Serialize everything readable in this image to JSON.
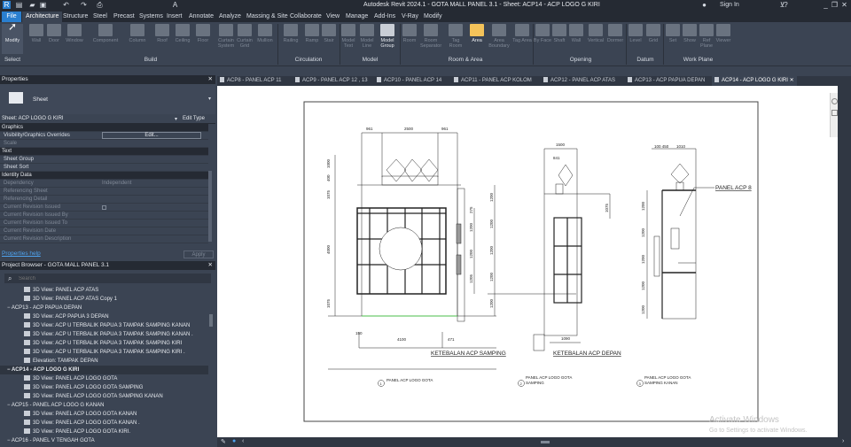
{
  "window": {
    "title": "Autodesk Revit 2024.1 - GOTA MALL PANEL 3.1 - Sheet: ACP14 - ACP LOGO G KIRI",
    "sign_in": "Sign In"
  },
  "ribbon_tabs": [
    "File",
    "Architecture",
    "Structure",
    "Steel",
    "Precast",
    "Systems",
    "Insert",
    "Annotate",
    "Analyze",
    "Massing & Site",
    "Collaborate",
    "View",
    "Manage",
    "Add-Ins",
    "V-Ray",
    "Modify"
  ],
  "tools": {
    "modify": "Modify",
    "wall": "Wall",
    "door": "Door",
    "window": "Window",
    "component": "Component",
    "column": "Column",
    "roof": "Roof",
    "ceiling": "Ceiling",
    "floor": "Floor",
    "curtain_system": "Curtain System",
    "curtain_grid": "Curtain Grid",
    "mullion": "Mullion",
    "railing": "Railing",
    "ramp": "Ramp",
    "stair": "Stair",
    "model_text": "Model Text",
    "model_line": "Model Line",
    "model_group": "Model Group",
    "room": "Room",
    "room_separator": "Room Separator",
    "tag_room": "Tag Room",
    "area": "Area",
    "area_boundary": "Area Boundary",
    "tag_area": "Tag Area",
    "by_face": "By Face",
    "shaft": "Shaft",
    "wall_opening": "Wall",
    "vertical": "Vertical",
    "dormer": "Dormer",
    "level": "Level",
    "grid": "Grid",
    "set": "Set",
    "show": "Show",
    "ref_plane": "Ref Plane",
    "viewer": "Viewer"
  },
  "panels": {
    "select": "Select",
    "build": "Build",
    "circulation": "Circulation",
    "model": "Model",
    "room_area": "Room & Area",
    "opening": "Opening",
    "datum": "Datum",
    "work_plane": "Work Plane"
  },
  "properties": {
    "title": "Properties",
    "type": "Sheet",
    "selector": "Sheet: ACP LOGO G KIRI",
    "edit_type": "Edit Type",
    "help": "Properties help",
    "apply": "Apply",
    "groups": {
      "graphics": "Graphics",
      "text": "Text",
      "identity": "Identity Data"
    },
    "rows": {
      "vis": "Visibility/Graphics Overrides",
      "vis_btn": "Edit...",
      "scale": "Scale",
      "sheet_group": "Sheet Group",
      "sheet_sort": "Sheet Sort",
      "dependency": "Dependency",
      "dependency_val": "Independent",
      "ref_sheet": "Referencing Sheet",
      "ref_detail": "Referencing Detail",
      "rev_issued": "Current Revision Issued",
      "rev_issued_by": "Current Revision Issued By",
      "rev_issued_to": "Current Revision Issued To",
      "rev_date": "Current Revision Date",
      "rev_desc": "Current Revision Description"
    }
  },
  "browser": {
    "title": "Project Browser - GOTA MALL PANEL 3.1",
    "search_placeholder": "Search",
    "items": [
      {
        "label": "3D View: PANEL ACP ATAS",
        "level": 2
      },
      {
        "label": "3D View: PANEL ACP ATAS Copy 1",
        "level": 2
      },
      {
        "label": "ACP13 - ACP PAPUA DEPAN",
        "level": 1
      },
      {
        "label": "3D View: ACP PAPUA 3 DEPAN",
        "level": 2
      },
      {
        "label": "3D View: ACP U TERBALIK PAPUA 3 TAMPAK SAMPING KANAN",
        "level": 2
      },
      {
        "label": "3D View: ACP U TERBALIK PAPUA 3 TAMPAK SAMPING KANAN .",
        "level": 2
      },
      {
        "label": "3D View: ACP U TERBALIK PAPUA 3 TAMPAK SAMPING KIRI",
        "level": 2
      },
      {
        "label": "3D View: ACP U TERBALIK PAPUA 3 TAMPAK SAMPING KIRI .",
        "level": 2
      },
      {
        "label": "Elevation: TAMPAK DEPAN",
        "level": 2
      },
      {
        "label": "ACP14 - ACP LOGO G KIRI",
        "level": 1,
        "selected": true
      },
      {
        "label": "3D View: PANEL ACP LOGO GOTA",
        "level": 2
      },
      {
        "label": "3D View: PANEL ACP LOGO GOTA SAMPING",
        "level": 2
      },
      {
        "label": "3D View: PANEL ACP LOGO GOTA SAMPING KANAN",
        "level": 2
      },
      {
        "label": "ACP15 - PANEL ACP LOGO G KANAN",
        "level": 1
      },
      {
        "label": "3D View: PANEL ACP LOGO GOTA KANAN",
        "level": 2
      },
      {
        "label": "3D View: PANEL ACP LOGO GOTA KANAN .",
        "level": 2
      },
      {
        "label": "3D View: PANEL ACP LOGO GOTA KIRI.",
        "level": 2
      },
      {
        "label": "ACP16 - PANEL V TENGAH GOTA",
        "level": 1
      }
    ]
  },
  "view_tabs": [
    "ACP8 - PANEL ACP 11",
    "ACP9 - PANEL ACP 12 , 13",
    "ACP10 - PANEL ACP 14",
    "ACP11 - PANEL ACP KOLOM",
    "ACP12 - PANEL ACP ATAS",
    "ACP13 - ACP PAPUA DEPAN",
    "ACP14 - ACP LOGO G KIRI"
  ],
  "drawing": {
    "dims_top": [
      "961",
      "2500",
      "961"
    ],
    "dims_left": [
      "1000",
      "400",
      "1075",
      "4000",
      "1075"
    ],
    "dims_right": [
      "1200",
      "1200",
      "1200",
      "1200",
      "1200"
    ],
    "dims_inner": [
      "275",
      "1200",
      "1200",
      "1205"
    ],
    "dims_bottom": [
      "4100",
      "471",
      "150"
    ],
    "note1": "KETEBALAN ACP SAMPING",
    "note2": "KETEBALAN ACP DEPAN",
    "note3": "PANEL ACP 8",
    "side_top": "1500",
    "side_top2": "841",
    "side_1075": "1075",
    "side_bottom": "1090",
    "right_top1": "100 450",
    "right_top2": "1010",
    "view1": {
      "num": "1",
      "name": "PANEL ACP LOGO GOTA"
    },
    "view2": {
      "num": "2",
      "name": "PANEL ACP LOGO GOTA",
      "name2": "SAMPING"
    },
    "view3": {
      "num": "3",
      "name": "PANEL ACP LOGO GOTA",
      "name2": "SAMPING KANAN"
    }
  },
  "watermark": {
    "title": "Activate Windows",
    "sub": "Go to Settings to activate Windows."
  }
}
